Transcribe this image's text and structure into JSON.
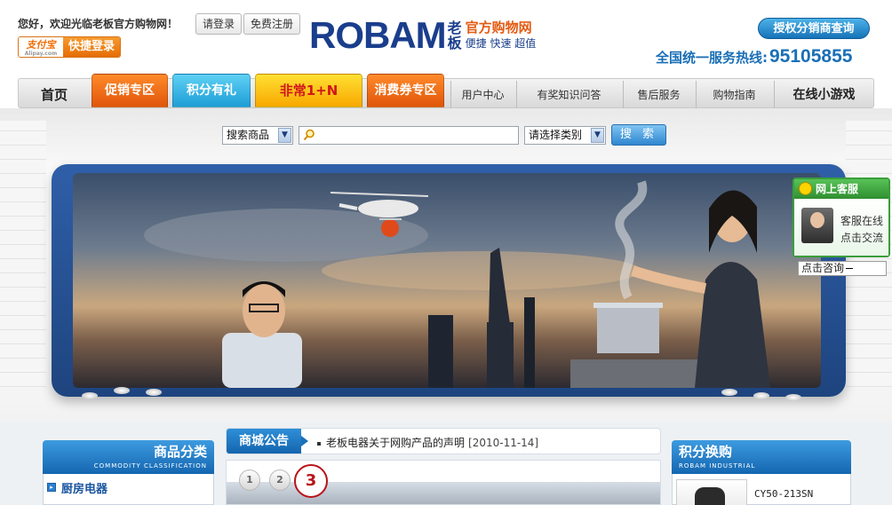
{
  "header": {
    "welcome": "您好，欢迎光临老板官方购物网！",
    "login_label": "请登录",
    "register_label": "免费注册",
    "alipay_logo": "支付宝",
    "alipay_sub": "Alipay.com",
    "alipay_quick": "快捷登录",
    "logo_mark": "ROBAM",
    "logo_cn_top": "老",
    "logo_cn_bottom": "板",
    "logo_title": "官方购物网",
    "logo_slogan": "便捷 快速 超值",
    "authorized_query": "授权分销商查询",
    "hotline_label": "全国统一服务热线:",
    "hotline_number": "95105855"
  },
  "nav": {
    "home": "首页",
    "promo": "促销专区",
    "points": "积分有礼",
    "special": "非常1+N",
    "coupon": "消费券专区",
    "user_center": "用户中心",
    "quiz": "有奖知识问答",
    "after_sales": "售后服务",
    "guide": "购物指南",
    "games": "在线小游戏"
  },
  "search": {
    "kind_selected": "搜索商品",
    "query_value": "",
    "category_selected": "请选择类别",
    "button_label": "搜 索"
  },
  "service": {
    "title": "网上客服",
    "line1": "客服在线",
    "line2": "点击交流",
    "ask": "点击咨询"
  },
  "categories": {
    "title": "商品分类",
    "subtitle": "COMMODITY CLASSIFICATION",
    "first_item": "厨房电器"
  },
  "notice": {
    "tag": "商城公告",
    "text": "老板电器关于网购产品的声明",
    "date": "[2010-11-14]"
  },
  "slider": {
    "pages": [
      "1",
      "2",
      "3"
    ],
    "active_page": "3"
  },
  "points_exchange": {
    "title": "积分换购",
    "subtitle": "ROBAM INDUSTRIAL",
    "first_item": "CY50-213SN"
  },
  "colors": {
    "brand_blue": "#1a3e8c",
    "accent_orange": "#e35b12",
    "nav_promo": "#e0560a",
    "nav_points": "#1e9ed7",
    "nav_special": "#f8a800",
    "service_green": "#2f8f2f"
  }
}
